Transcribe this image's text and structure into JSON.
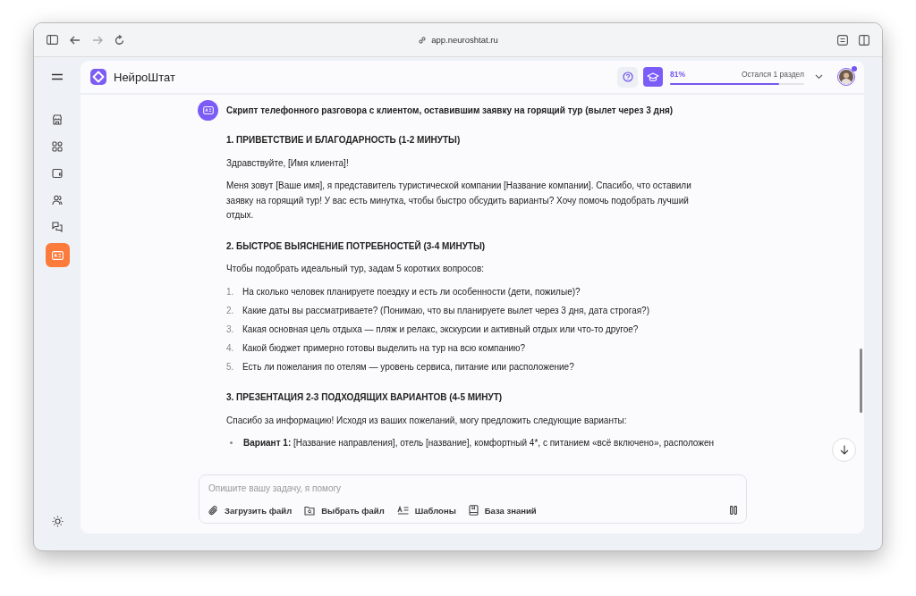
{
  "browser": {
    "url": "app.neuroshtat.ru"
  },
  "sidebar": {
    "items": [
      {
        "selected": false
      },
      {
        "selected": false
      },
      {
        "selected": false
      },
      {
        "selected": false
      },
      {
        "selected": false
      },
      {
        "selected": true
      }
    ]
  },
  "header": {
    "logo_text": "НейроШтат",
    "progress": {
      "percent": "81%",
      "level": 0.81,
      "caption": "Остался 1 раздел"
    }
  },
  "chat": {
    "title": "Скрипт телефонного разговора с клиентом, оставившим заявку на горящий тур (вылет через 3 дня)",
    "blocks": [
      {
        "kind": "heading",
        "text": "1. ПРИВЕТСТВИЕ И БЛАГОДАРНОСТЬ (1-2 МИНУТЫ)"
      },
      {
        "kind": "paragraph",
        "text": "Здравствуйте, [Имя клиента]!"
      },
      {
        "kind": "paragraph",
        "text": "Меня зовут [Ваше имя], я представитель туристической компании [Название компании]. Спасибо, что оставили заявку на горящий тур! У вас есть минутка, чтобы быстро обсудить варианты? Хочу помочь подобрать лучший отдых."
      },
      {
        "kind": "heading",
        "text": "2. БЫСТРОЕ ВЫЯСНЕНИЕ ПОТРЕБНОСТЕЙ (3-4 МИНУТЫ)"
      },
      {
        "kind": "paragraph",
        "text": "Чтобы подобрать идеальный тур, задам 5 коротких вопросов:"
      },
      {
        "kind": "numbered",
        "items": [
          {
            "marker": "1.",
            "text": "На сколько человек планируете поездку и есть ли особенности (дети, пожилые)?"
          },
          {
            "marker": "2.",
            "text": "Какие даты вы рассматриваете? (Понимаю, что вы планируете вылет через 3 дня, дата строгая?)"
          },
          {
            "marker": "3.",
            "text": "Какая основная цель отдыха — пляж и релакс, экскурсии и активный отдых или что-то другое?"
          },
          {
            "marker": "4.",
            "text": "Какой бюджет примерно готовы выделить на тур на всю компанию?"
          },
          {
            "marker": "5.",
            "text": "Есть ли пожелания по отелям — уровень сервиса, питание или расположение?"
          }
        ]
      },
      {
        "kind": "heading",
        "text": "3. ПРЕЗЕНТАЦИЯ 2-3 ПОДХОДЯЩИХ ВАРИАНТОВ (4-5 МИНУТ)"
      },
      {
        "kind": "paragraph",
        "text": "Спасибо за информацию! Исходя из ваших пожеланий, могу предложить следующие варианты:"
      },
      {
        "kind": "bullets",
        "items": [
          {
            "text": "**Вариант 1:** [Название направления], отель [название], комфортный 4*, с питанием «всё включено», расположен"
          }
        ]
      }
    ]
  },
  "composer": {
    "placeholder": "Опишите вашу задачу, я помогу",
    "tools": [
      {
        "label": "Загрузить файл"
      },
      {
        "label": "Выбрать файл"
      },
      {
        "label": "Шаблоны"
      },
      {
        "label": "База знаний"
      }
    ]
  }
}
